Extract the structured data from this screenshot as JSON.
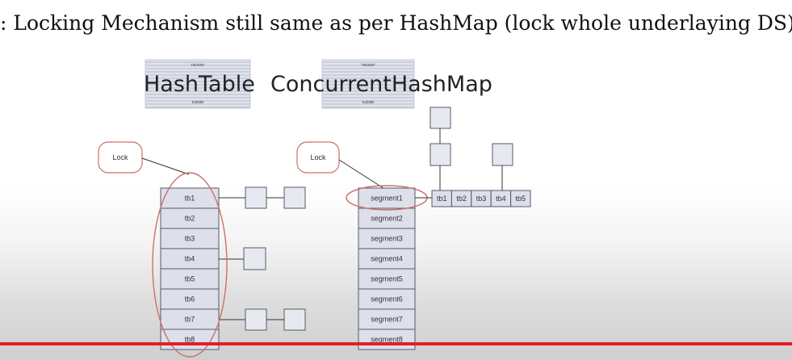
{
  "caption": ": Locking Mechanism still same as per HashMap (lock whole underlaying DS)",
  "diagram": {
    "hashtable": {
      "title": "HashTable",
      "card_date": "7/6/2007",
      "card_subtitle": "Subtitle",
      "lock_label": "Lock",
      "buckets": [
        "tb1",
        "tb2",
        "tb3",
        "tb4",
        "tb5",
        "tb6",
        "tb7",
        "tb8"
      ]
    },
    "concurrent": {
      "title": "ConcurrentHashMap",
      "card_date": "7/6/2007",
      "card_subtitle": "Subtitle",
      "lock_label": "Lock",
      "segments": [
        "segment1",
        "segment2",
        "segment3",
        "segment4",
        "segment5",
        "segment6",
        "segment7",
        "segment8"
      ],
      "segment1_buckets": [
        "tb1",
        "tb2",
        "tb3",
        "tb4",
        "tb5"
      ]
    },
    "colors": {
      "highlight": "#c9706b",
      "cell_fill": "#dde0eb",
      "divider_line": "#e21f26"
    }
  }
}
